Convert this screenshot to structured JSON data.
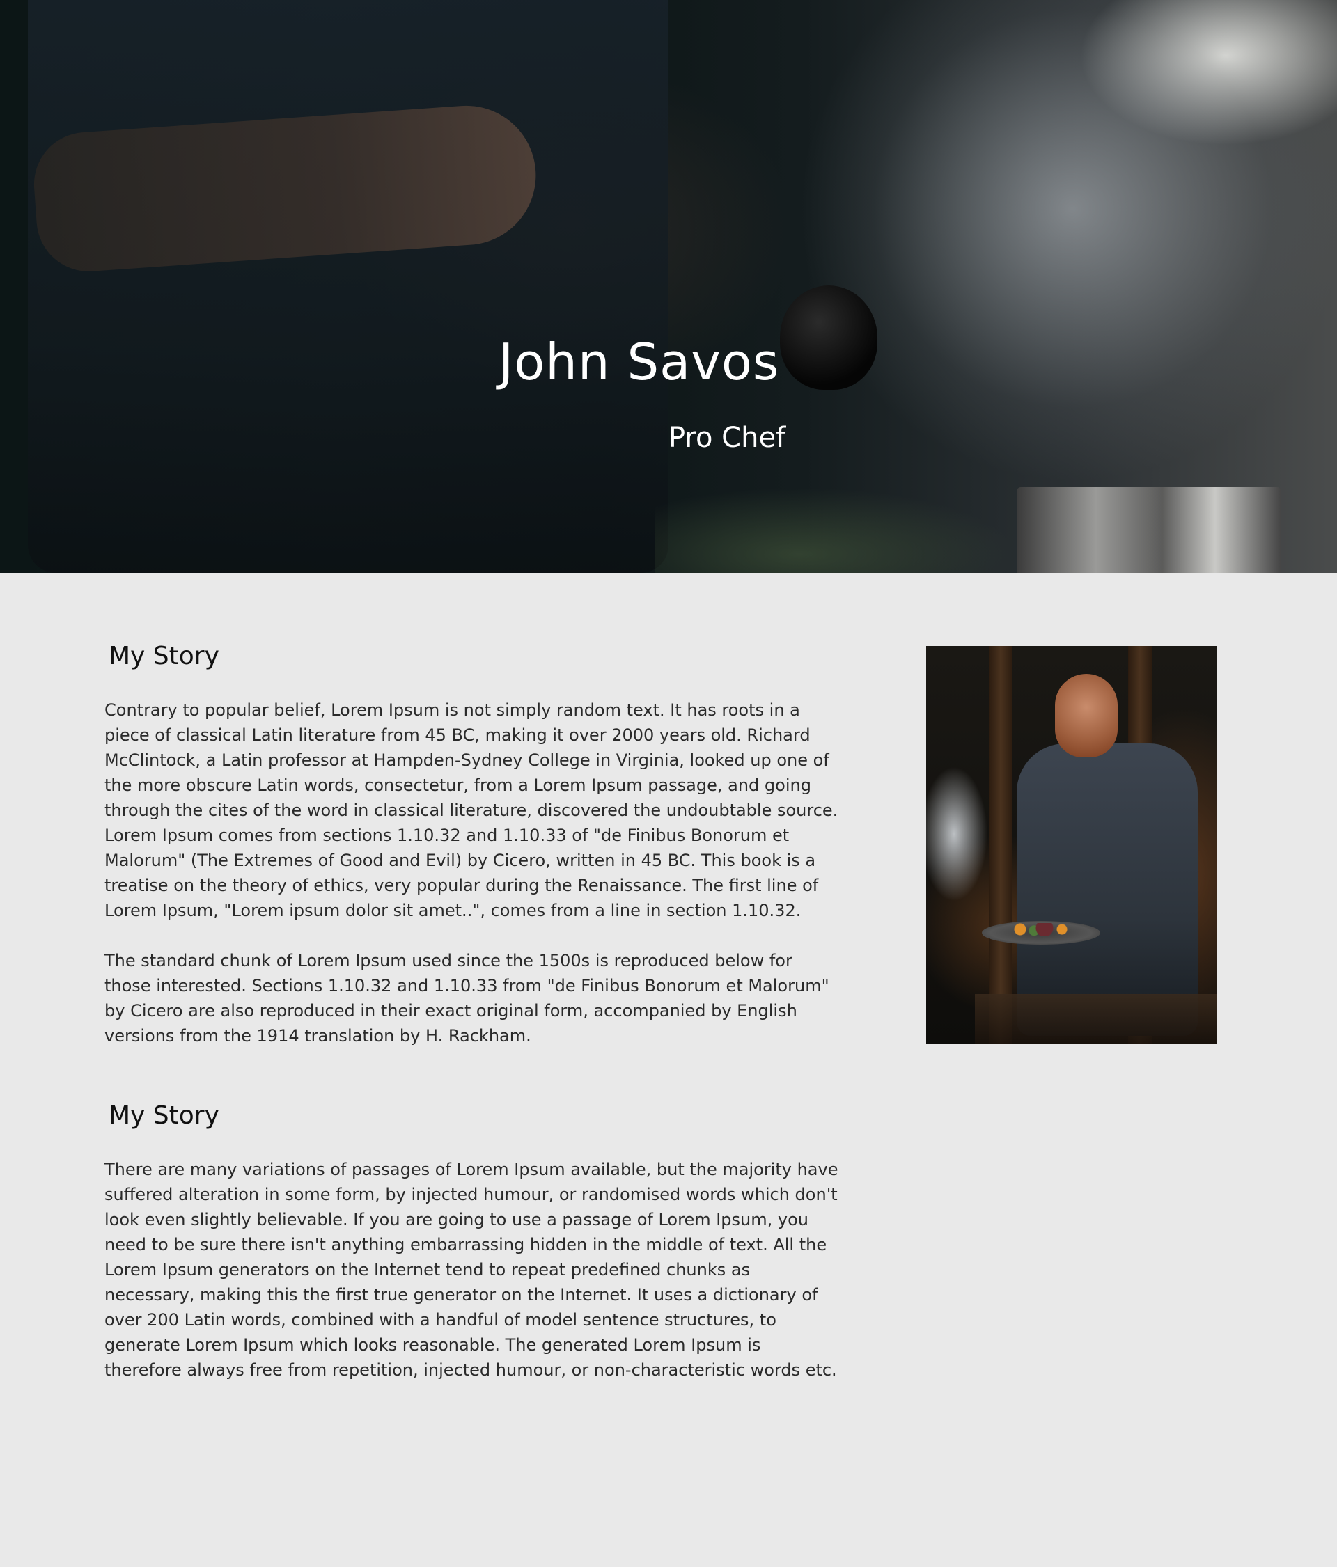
{
  "hero": {
    "name": "John Savos",
    "role": "Pro Chef"
  },
  "sections": [
    {
      "heading": "My Story",
      "paragraphs": [
        "Contrary to popular belief, Lorem Ipsum is not simply random text. It has roots in a piece of classical Latin literature from 45 BC, making it over 2000 years old. Richard McClintock, a Latin professor at Hampden-Sydney College in Virginia, looked up one of the more obscure Latin words, consectetur, from a Lorem Ipsum passage, and going through the cites of the word in classical literature, discovered the undoubtable source. Lorem Ipsum comes from sections 1.10.32 and 1.10.33 of \"de Finibus Bonorum et Malorum\" (The Extremes of Good and Evil) by Cicero, written in 45 BC. This book is a treatise on the theory of ethics, very popular during the Renaissance. The first line of Lorem Ipsum, \"Lorem ipsum dolor sit amet..\", comes from a line in section 1.10.32.",
        "The standard chunk of Lorem Ipsum used since the 1500s is reproduced below for those interested. Sections 1.10.32 and 1.10.33 from \"de Finibus Bonorum et Malorum\" by Cicero are also reproduced in their exact original form, accompanied by English versions from the 1914 translation by H. Rackham."
      ]
    },
    {
      "heading": "My Story",
      "paragraphs": [
        "There are many variations of passages of Lorem Ipsum available, but the majority have suffered alteration in some form, by injected humour, or randomised words which don't look even slightly believable. If you are going to use a passage of Lorem Ipsum, you need to be sure there isn't anything embarrassing hidden in the middle of text. All the Lorem Ipsum generators on the Internet tend to repeat predefined chunks as necessary, making this the first true generator on the Internet. It uses a dictionary of over 200 Latin words, combined with a handful of model sentence structures, to generate Lorem Ipsum which looks reasonable. The generated Lorem Ipsum is therefore always free from repetition, injected humour, or non-characteristic words etc."
      ]
    }
  ],
  "colors": {
    "page_background": "#e9e9e9",
    "heading_text": "#111111",
    "body_text": "#2a2a2a",
    "hero_text": "#ffffff"
  }
}
